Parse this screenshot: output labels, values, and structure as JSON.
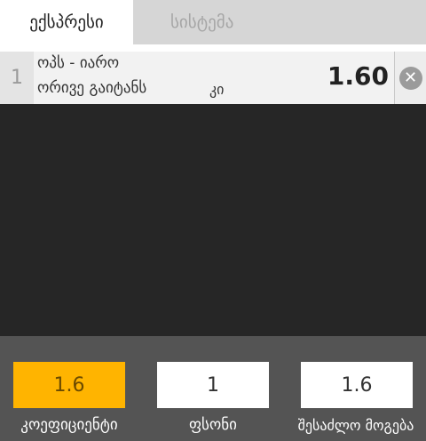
{
  "tabs": {
    "express": "ექსპრესი",
    "system": "სისტემა"
  },
  "bet": {
    "number": "1",
    "match": "ოპს - იარო",
    "market": "ორივე გაიტანს",
    "pick": "კი",
    "odds": "1.60",
    "remove_icon": "close-circle-icon"
  },
  "footer": {
    "coefficient_value": "1.6",
    "stake_value": "1",
    "possible_win_value": "1.6",
    "coefficient_label": "კოეფიციენტი",
    "stake_label": "ფსონი",
    "possible_win_label": "შესაძლო მოგება"
  },
  "colors": {
    "accent": "#ffb400",
    "background": "#262626",
    "footer": "#545454"
  }
}
